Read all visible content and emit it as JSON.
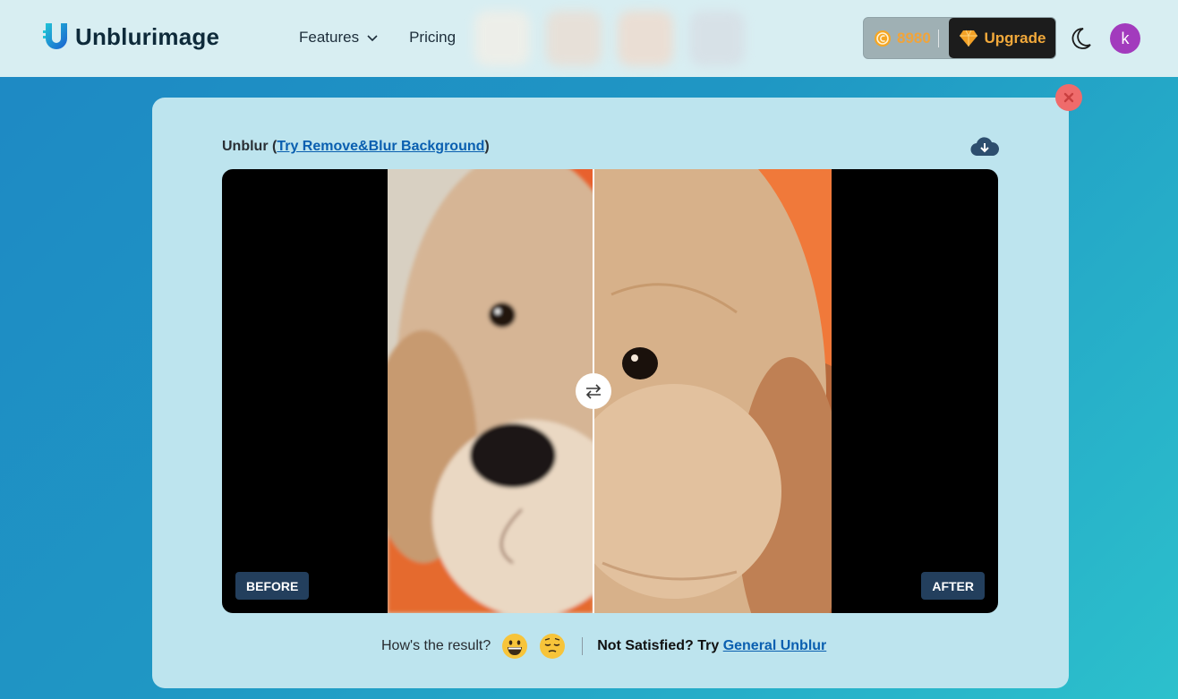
{
  "header": {
    "logo_text": "Unblurimage",
    "nav": [
      {
        "label": "Features",
        "has_dropdown": true
      },
      {
        "label": "Pricing",
        "has_dropdown": false
      }
    ],
    "credits": "8980",
    "upgrade_label": "Upgrade",
    "avatar_initial": "k",
    "icons": [
      "logo-icon",
      "chevron-down-icon",
      "coin-icon",
      "gem-icon",
      "moon-icon"
    ]
  },
  "modal": {
    "title_prefix": "Unblur (",
    "title_link": "Try Remove&Blur Background",
    "title_suffix": ")",
    "before_label": "BEFORE",
    "after_label": "AFTER",
    "feedback_question": "How's the result?",
    "feedback_emojis": [
      "grinning-face",
      "pensive-face"
    ],
    "not_satisfied": "Not Satisfied? Try ",
    "general_link": "General Unblur"
  },
  "colors": {
    "accent_link": "#0a5fb0",
    "upgrade_text": "#f2a93b",
    "avatar": "#a23bbd",
    "close": "#ef6b6b",
    "tag_bg": "#233f5d"
  }
}
